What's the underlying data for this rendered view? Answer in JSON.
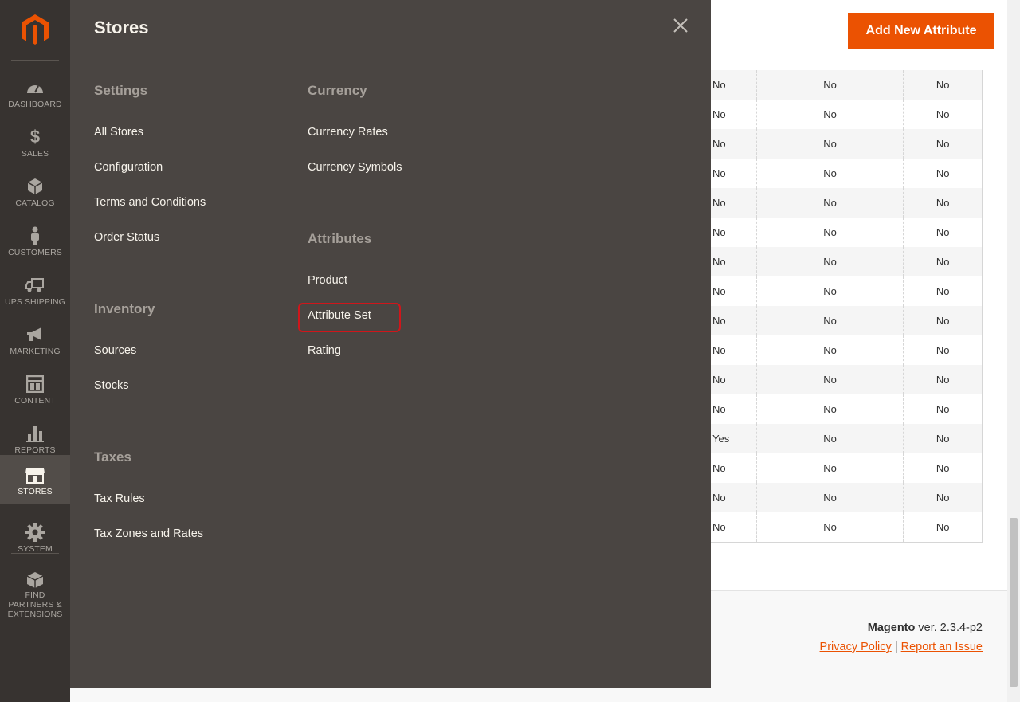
{
  "nav": {
    "logo_alt": "Magento",
    "items": [
      {
        "label": "DASHBOARD",
        "icon": "dashboard-icon"
      },
      {
        "label": "SALES",
        "icon": "dollar-icon"
      },
      {
        "label": "CATALOG",
        "icon": "box-icon"
      },
      {
        "label": "CUSTOMERS",
        "icon": "person-icon"
      },
      {
        "label": "UPS SHIPPING",
        "icon": "truck-icon"
      },
      {
        "label": "MARKETING",
        "icon": "megaphone-icon"
      },
      {
        "label": "CONTENT",
        "icon": "layout-icon"
      },
      {
        "label": "REPORTS",
        "icon": "bar-chart-icon"
      },
      {
        "label": "STORES",
        "icon": "storefront-icon"
      },
      {
        "label": "SYSTEM",
        "icon": "gear-icon"
      },
      {
        "label": "FIND PARTNERS & EXTENSIONS",
        "icon": "blocks-icon"
      }
    ],
    "active": "STORES"
  },
  "flyout": {
    "title": "Stores",
    "columns": {
      "settings": {
        "heading": "Settings",
        "links": [
          "All Stores",
          "Configuration",
          "Terms and Conditions",
          "Order Status"
        ]
      },
      "inventory": {
        "heading": "Inventory",
        "links": [
          "Sources",
          "Stocks"
        ]
      },
      "taxes": {
        "heading": "Taxes",
        "links": [
          "Tax Rules",
          "Tax Zones and Rates"
        ]
      },
      "currency": {
        "heading": "Currency",
        "links": [
          "Currency Rates",
          "Currency Symbols"
        ]
      },
      "attributes": {
        "heading": "Attributes",
        "links": [
          "Product",
          "Attribute Set",
          "Rating"
        ]
      }
    },
    "highlighted": "Attribute Set"
  },
  "header": {
    "add_button_label": "Add New Attribute"
  },
  "grid": {
    "rows": [
      [
        "No",
        "No",
        "No"
      ],
      [
        "No",
        "No",
        "No"
      ],
      [
        "No",
        "No",
        "No"
      ],
      [
        "No",
        "No",
        "No"
      ],
      [
        "No",
        "No",
        "No"
      ],
      [
        "No",
        "No",
        "No"
      ],
      [
        "No",
        "No",
        "No"
      ],
      [
        "No",
        "No",
        "No"
      ],
      [
        "No",
        "No",
        "No"
      ],
      [
        "No",
        "No",
        "No"
      ],
      [
        "No",
        "No",
        "No"
      ],
      [
        "No",
        "No",
        "No"
      ],
      [
        "Yes",
        "No",
        "No"
      ],
      [
        "No",
        "No",
        "No"
      ],
      [
        "No",
        "No",
        "No"
      ],
      [
        "No",
        "No",
        "No"
      ]
    ]
  },
  "footer": {
    "brand": "Magento",
    "version": "ver. 2.3.4-p2",
    "privacy_link": "Privacy Policy",
    "separator": "|",
    "report_link": "Report an Issue"
  },
  "colors": {
    "accent": "#eb5202",
    "nav_bg": "#373330",
    "flyout_bg": "#4a4542",
    "highlight": "#d0161b"
  }
}
